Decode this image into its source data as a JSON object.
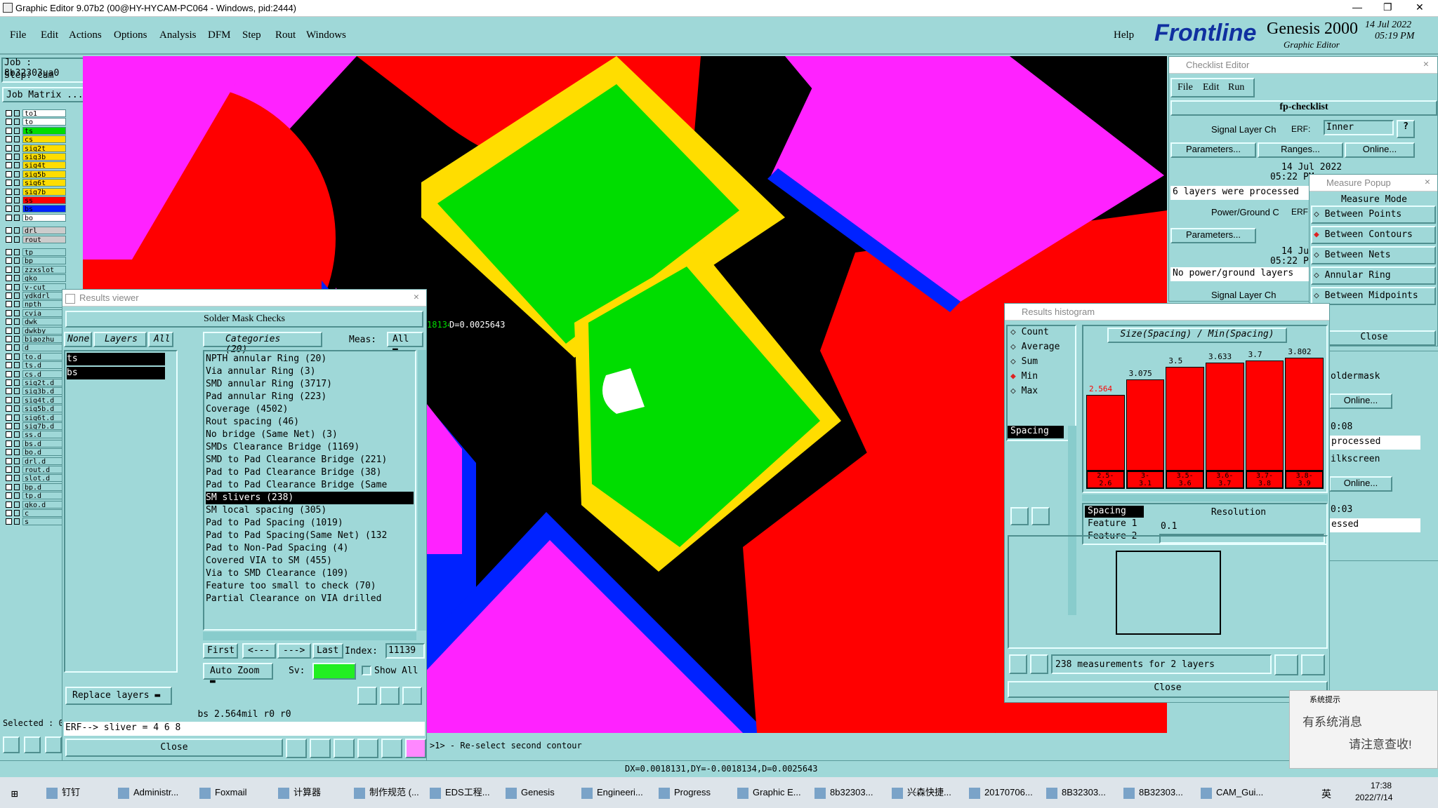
{
  "window": {
    "title": "Graphic Editor 9.07b2 (00@HY-HYCAM-PC064 - Windows, pid:2444)"
  },
  "menu": {
    "items": [
      "File",
      "Edit",
      "Actions",
      "Options",
      "Analysis",
      "DFM",
      "Step",
      "Rout",
      "Windows"
    ],
    "help": "Help"
  },
  "brand": {
    "logo": "Frontline",
    "product": "Genesis 2000",
    "sub": "Graphic Editor",
    "date": "14 Jul 2022",
    "time": "05:19 PM"
  },
  "job": {
    "job": "Job  : 8b32303ua0",
    "step": "Step: cam",
    "matrix": "Job Matrix ..."
  },
  "layers": [
    "to1",
    "to",
    "ts",
    "cs",
    "sig2t",
    "sig3b",
    "sig4t",
    "sig5b",
    "sig6t",
    "sig7b",
    "ss",
    "bs",
    "bo",
    "drl",
    "rout",
    "tp",
    "bp",
    "zzxslot",
    "gko",
    "v-cut",
    "ydkdrl",
    "npth",
    "cvia",
    "dwk",
    "dwkby",
    "biaozhu",
    "d",
    "to.d",
    "ts.d",
    "cs.d",
    "sig2t.d",
    "sig3b.d",
    "sig4t.d",
    "sig5b.d",
    "sig6t.d",
    "sig7b.d",
    "ss.d",
    "bs.d",
    "bo.d",
    "drl.d",
    "rout.d",
    "slot.d",
    "bp.d",
    "tp.d",
    "gko.d",
    "c",
    "s"
  ],
  "selected": "Selected : 0",
  "results_viewer": {
    "title": "Results viewer",
    "header": "Solder Mask Checks",
    "none": "None",
    "layers_label": "Layers",
    "all": "All",
    "categories_label": "Categories (20)",
    "meas_label": "Meas:",
    "meas_value": "All",
    "layer_items": [
      "ts",
      "bs"
    ],
    "categories": [
      "NPTH annular Ring (20)",
      "Via annular Ring (3)",
      "SMD annular Ring (3717)",
      "Pad annular Ring (223)",
      "Coverage (4502)",
      "Rout spacing (46)",
      "No bridge (Same Net) (3)",
      "SMDs Clearance Bridge (1169)",
      "SMD to Pad Clearance Bridge (221)",
      "Pad to Pad Clearance Bridge (38)",
      "Pad to Pad Clearance Bridge (Same",
      "SM slivers (238)",
      "SM local spacing (305)",
      "Pad to Pad Spacing (1019)",
      "Pad to Pad Spacing(Same Net) (132",
      "Pad to Non-Pad Spacing (4)",
      "Covered VIA to SM (455)",
      "Via to SMD Clearance (109)",
      "Feature too small to check (70)",
      "Partial Clearance on VIA drilled"
    ],
    "selected_index": 11,
    "first": "First",
    "prev": "<---",
    "next": "--->",
    "last": "Last",
    "index_label": "Index:",
    "index_value": "11139",
    "auto_zoom": "Auto Zoom",
    "sv": "Sv:",
    "show_all": "Show All",
    "replace": "Replace layers",
    "status": "bs 2.564mil  r0  r0",
    "erf": "ERF--> sliver = 4 6 8",
    "close": "Close"
  },
  "canvas": {
    "measure_label": "DX=0.0018131,DY=-0.0018134,D=0.0025643",
    "measure_partial": "0.0018131,DY=-0.0018134,",
    "measure_tail": "D=0.0025643"
  },
  "checklist": {
    "title": "Checklist Editor",
    "menu": [
      "File",
      "Edit",
      "Run"
    ],
    "name": "fp-checklist",
    "item1": "Signal Layer Ch",
    "erf": "ERF:",
    "inner": "Inner",
    "params": "Parameters...",
    "ranges": "Ranges...",
    "online": "Online...",
    "date": "14 Jul 2022",
    "time": "05:22 PM -",
    "processed1": "6 layers were processed",
    "item2": "Power/Ground C",
    "erf2": "ERF",
    "date2": "14 Jul",
    "time2": "05:22 PM -",
    "processed2": "No power/ground layers",
    "item3": "Signal Layer Ch",
    "erf3": "ERF",
    "r1": "oldermask",
    "r2": "Online...",
    "r3": "0:08",
    "r4": "processed",
    "r5": "ilkscreen",
    "r6": "Online...",
    "r7": "0:03",
    "r8": "essed",
    "q": "?"
  },
  "measure": {
    "title": "Measure Popup",
    "mode": "Measure Mode",
    "options": [
      "Between Points",
      "Between Contours",
      "Between Nets",
      "Annular Ring",
      "Between Midpoints"
    ],
    "selected": 1,
    "close": "Close"
  },
  "histogram": {
    "title": "Results histogram",
    "stats": [
      "Count",
      "Average",
      "Sum",
      "Min",
      "Max"
    ],
    "selected_stat": 3,
    "spacing": "Spacing",
    "chart_title": "Size(Spacing) / Min(Spacing)",
    "resolution": "Resolution",
    "res_value": "0.1",
    "fields": [
      "Spacing",
      "Feature 1",
      "Feature 2"
    ],
    "summary": "238 measurements for 2 layers",
    "close": "Close",
    "chart_data": {
      "type": "bar",
      "title": "Size(Spacing) / Min(Spacing)",
      "categories": [
        "2.5-\n2.6",
        "3-\n3.1",
        "3.5-\n3.6",
        "3.6-\n3.7",
        "3.7-\n3.8",
        "3.8-\n3.9"
      ],
      "values": [
        2.564,
        3.075,
        3.5,
        3.633,
        3.7,
        3.802
      ],
      "labels": [
        "2.564",
        "3.075",
        "3.5",
        "3.633",
        "3.7",
        "3.802"
      ]
    }
  },
  "status": {
    "prompt": ">1> - Re-select second contour",
    "readout": "DX=0.0018131,DY=-0.0018134,D=0.0025643"
  },
  "toast": {
    "title": "系统提示",
    "line1": "有系统消息",
    "line2": "请注意查收!"
  },
  "taskbar": {
    "items": [
      "钉钉",
      "Administr...",
      "Foxmail",
      "计算器",
      "制作规范 (...",
      "EDS工程...",
      "Genesis",
      "Engineeri...",
      "Progress",
      "Graphic E...",
      "8b32303...",
      "兴森快捷...",
      "20170706...",
      "8B32303...",
      "8B32303...",
      "CAM_Gui..."
    ],
    "lang": "英",
    "time": "17:38",
    "date": "2022/7/14"
  },
  "colors": {
    "panel": "#9fd8d8",
    "red": "#ff0000",
    "green": "#00dd00",
    "yellow": "#ffdd00",
    "magenta": "#ff22ff",
    "blue": "#0022ff"
  }
}
